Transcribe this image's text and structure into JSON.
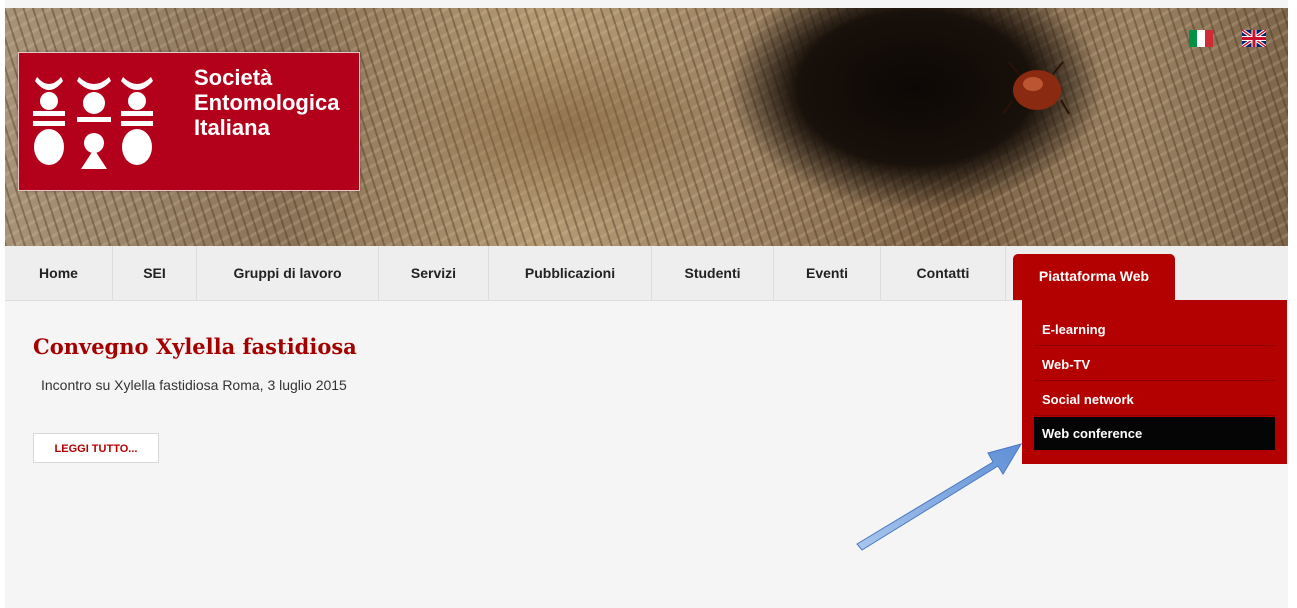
{
  "header": {
    "logo_text": [
      "Società",
      "Entomologica",
      "Italiana"
    ],
    "brand_color": "#b3001b",
    "languages": [
      {
        "code": "it",
        "flag": "italian-flag"
      },
      {
        "code": "en",
        "flag": "uk-flag"
      }
    ]
  },
  "nav": {
    "items": [
      {
        "label": "Home"
      },
      {
        "label": "SEI"
      },
      {
        "label": "Gruppi di lavoro"
      },
      {
        "label": "Servizi"
      },
      {
        "label": "Pubblicazioni"
      },
      {
        "label": "Studenti"
      },
      {
        "label": "Eventi"
      },
      {
        "label": "Contatti"
      },
      {
        "label": "Piattaforma Web",
        "active": true
      }
    ],
    "active_color": "#b30000"
  },
  "dropdown": {
    "items": [
      {
        "label": "E-learning"
      },
      {
        "label": "Web-TV"
      },
      {
        "label": "Social network"
      },
      {
        "label": "Web conference",
        "hovered": true
      }
    ]
  },
  "article": {
    "title": "Convegno Xylella fastidiosa",
    "text": "Incontro su Xylella fastidiosa Roma, 3 luglio 2015",
    "read_more": "LEGGI TUTTO..."
  },
  "annotation": {
    "arrow_color": "#7aa6e0"
  }
}
